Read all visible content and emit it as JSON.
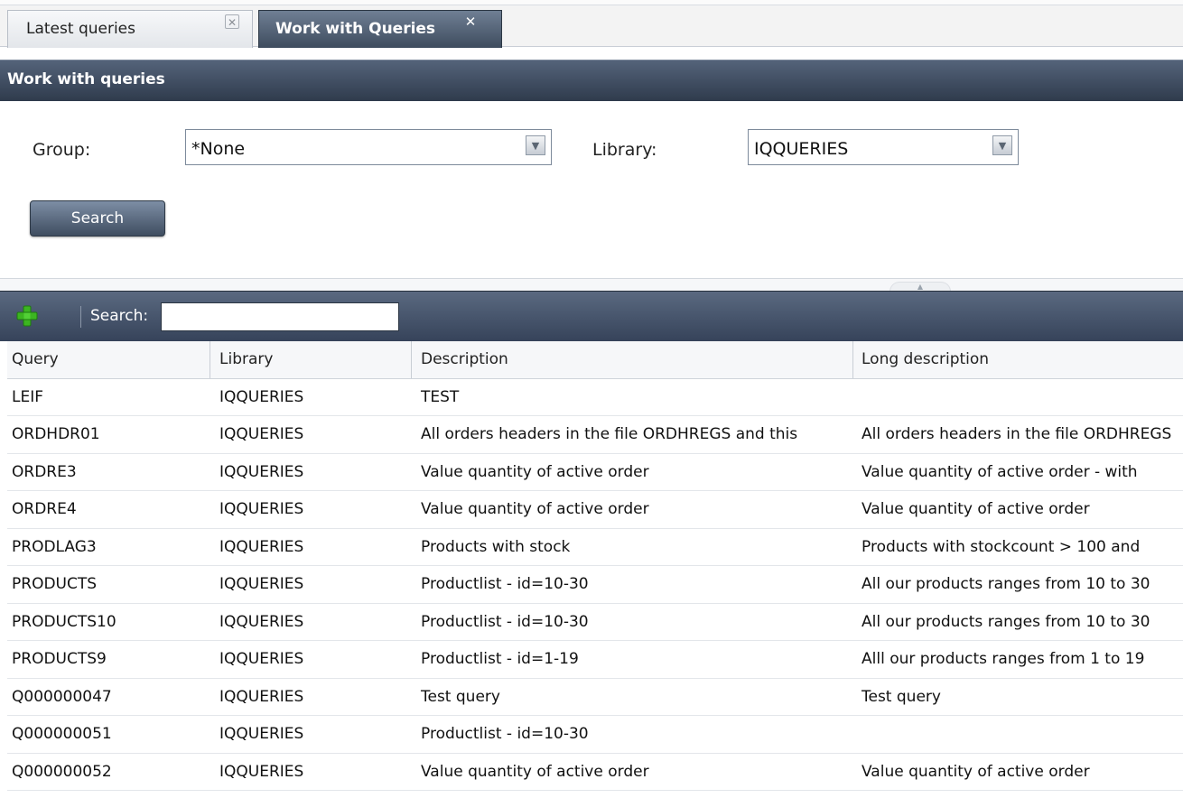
{
  "tabs": [
    {
      "label": "Latest queries",
      "active": false
    },
    {
      "label": "Work with Queries",
      "active": true
    }
  ],
  "panel": {
    "title": "Work with queries"
  },
  "form": {
    "group_label": "Group:",
    "group_value": "*None",
    "library_label": "Library:",
    "library_value": "IQQUERIES",
    "search_button": "Search"
  },
  "toolbar": {
    "search_label": "Search:",
    "search_value": ""
  },
  "table": {
    "columns": [
      "Query",
      "Library",
      "Description",
      "Long description"
    ],
    "rows": [
      [
        "LEIF",
        "IQQUERIES",
        "TEST",
        ""
      ],
      [
        "ORDHDR01",
        "IQQUERIES",
        "All orders headers in the file ORDHREGS and this",
        "All orders headers in the file ORDHREGS"
      ],
      [
        "ORDRE3",
        "IQQUERIES",
        "Value quantity of active order",
        "Value quantity of active order - with"
      ],
      [
        "ORDRE4",
        "IQQUERIES",
        "Value quantity of active order",
        "Value quantity of active order"
      ],
      [
        "PRODLAG3",
        "IQQUERIES",
        "Products with stock",
        "Products with stockcount > 100 and"
      ],
      [
        "PRODUCTS",
        "IQQUERIES",
        "Productlist - id=10-30",
        "All our products ranges from 10 to 30"
      ],
      [
        "PRODUCTS10",
        "IQQUERIES",
        "Productlist - id=10-30",
        "All our products ranges from 10 to 30"
      ],
      [
        "PRODUCTS9",
        "IQQUERIES",
        "Productlist - id=1-19",
        "Alll our products ranges from 1 to 19"
      ],
      [
        "Q000000047",
        "IQQUERIES",
        "Test query",
        "Test query"
      ],
      [
        "Q000000051",
        "IQQUERIES",
        "Productlist - id=10-30",
        ""
      ],
      [
        "Q000000052",
        "IQQUERIES",
        "Value quantity of active order",
        "Value quantity of active order"
      ]
    ]
  },
  "icons": {
    "tab_close": "close-icon",
    "combo_arrow": "chevron-down-icon",
    "add": "plus-icon",
    "add_color": "#3cb521"
  }
}
